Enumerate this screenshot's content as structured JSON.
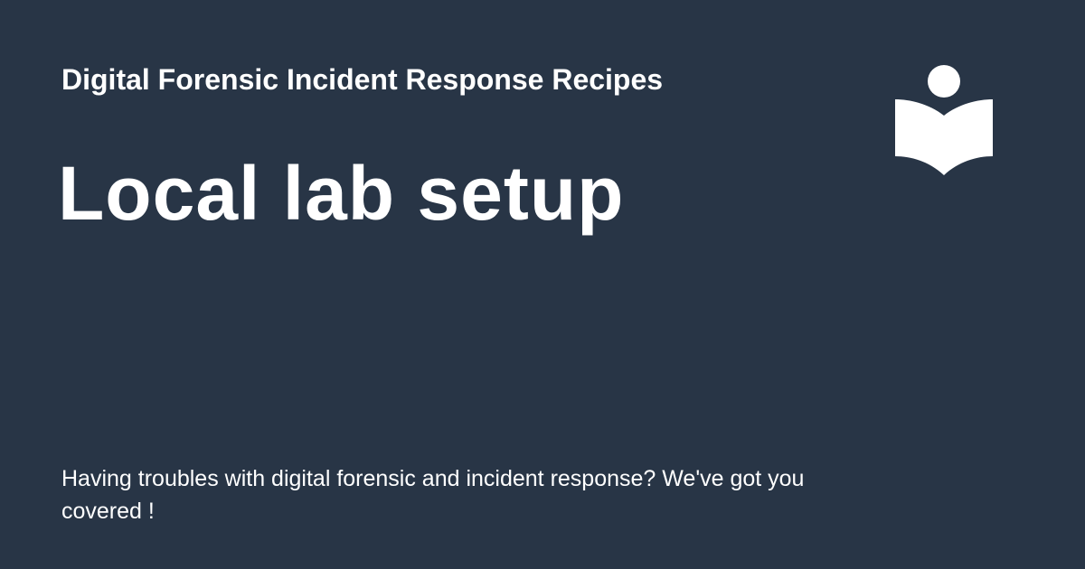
{
  "site": {
    "name": "Digital Forensic Incident Response Recipes"
  },
  "page": {
    "title": "Local lab setup",
    "description": "Having troubles with digital forensic and incident response? We've got you covered !"
  },
  "logo": {
    "icon": "reader-book-icon"
  },
  "colors": {
    "background": "#283546",
    "text": "#ffffff"
  }
}
